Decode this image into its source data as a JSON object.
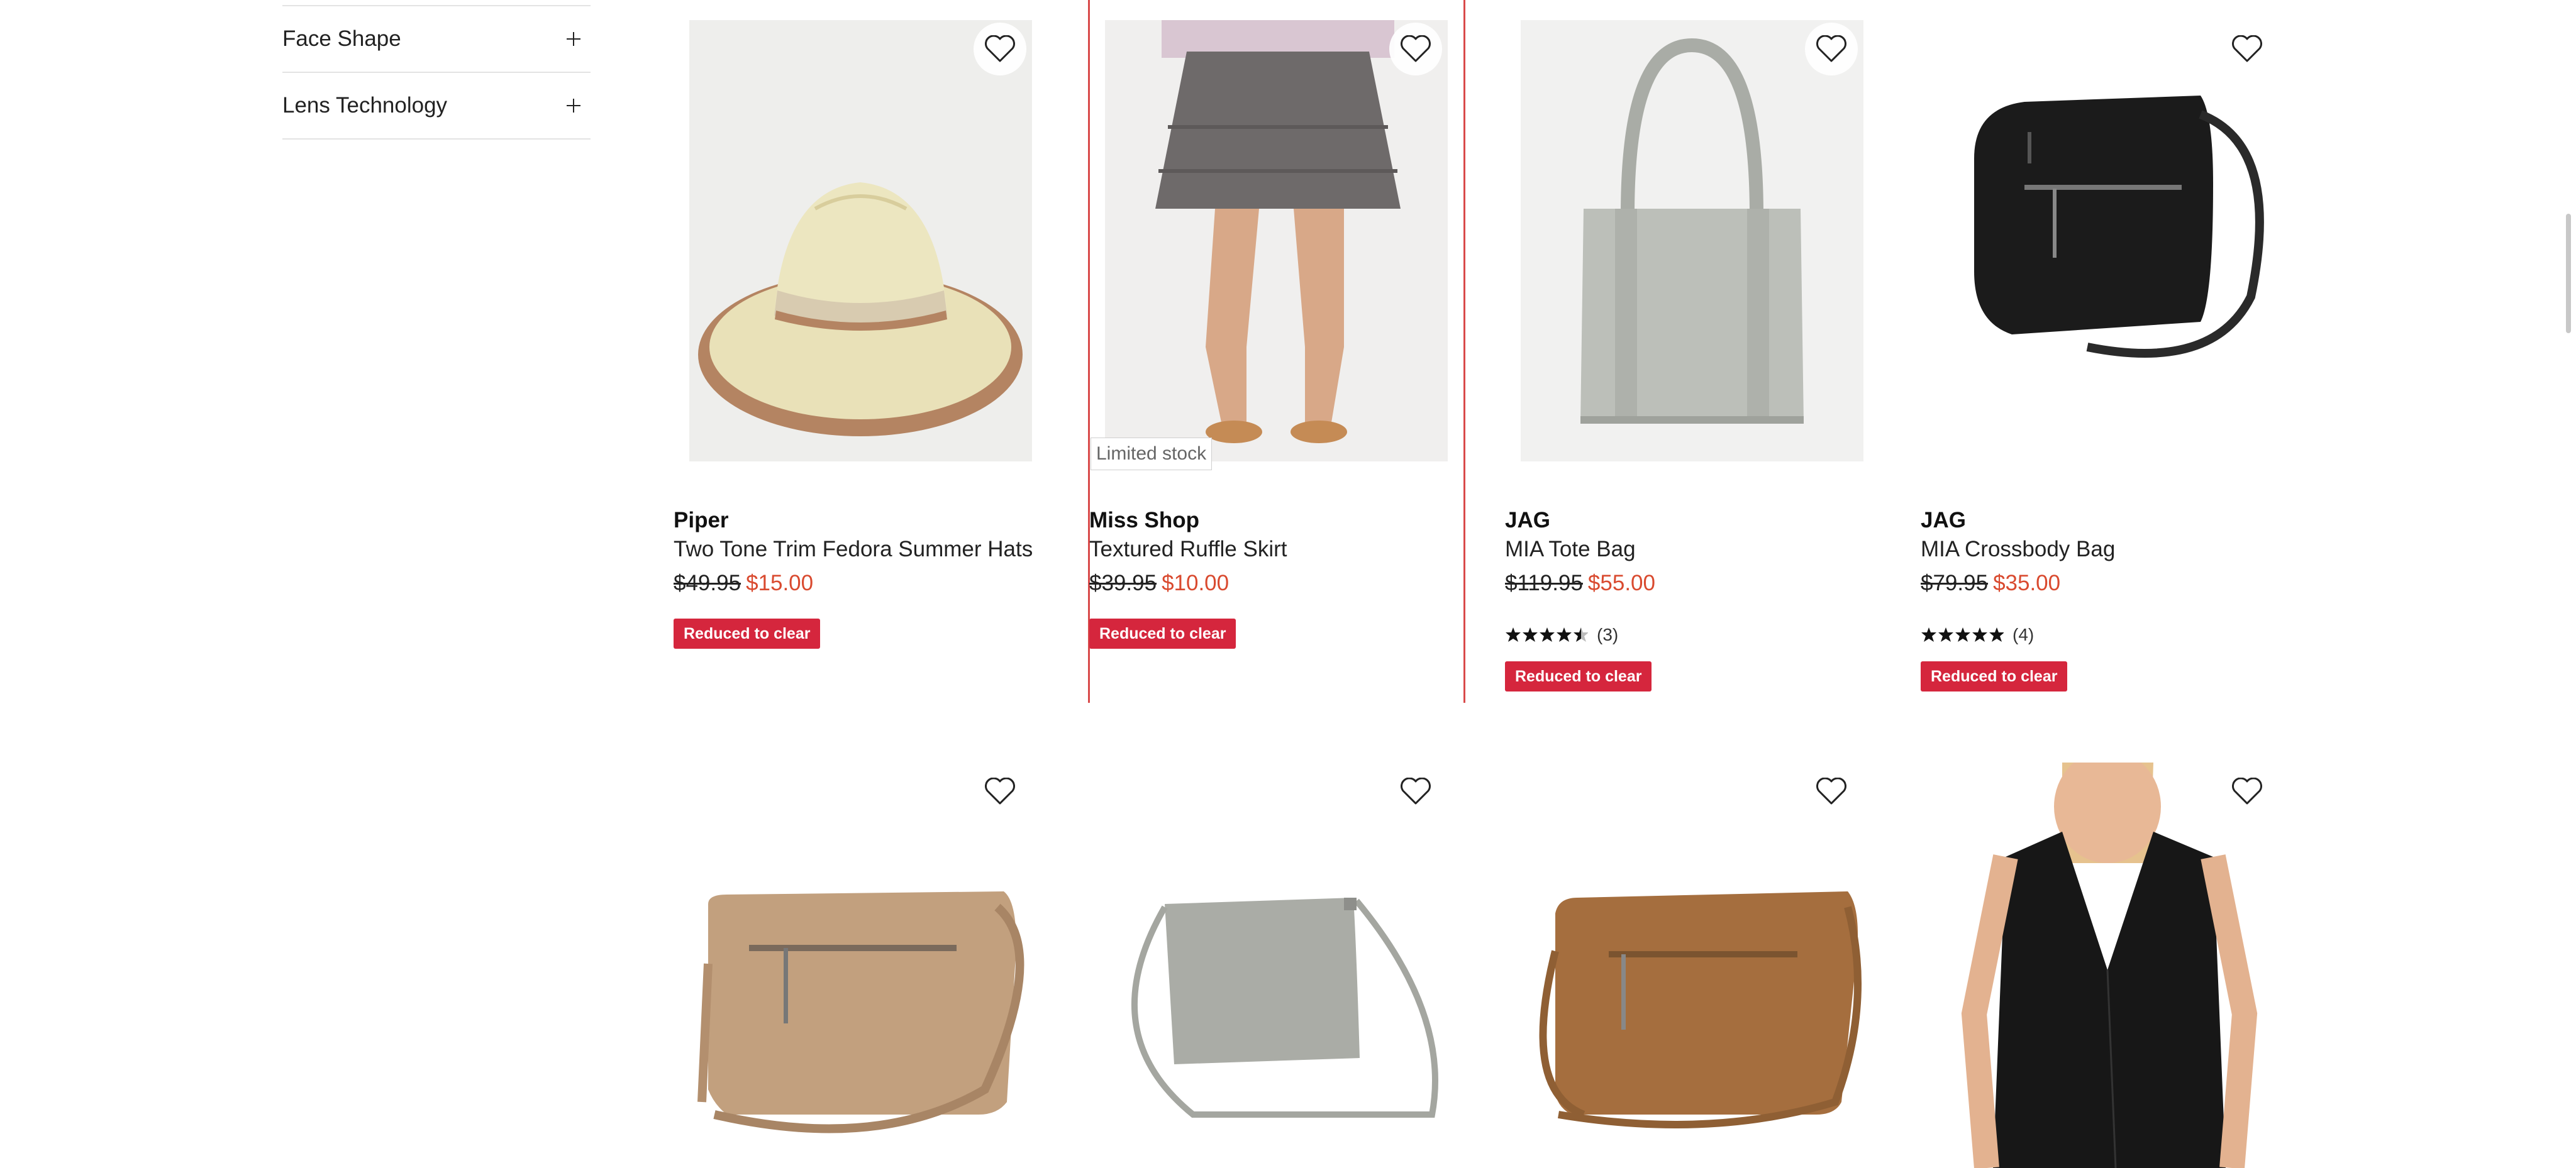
{
  "filters": [
    {
      "label": "Face Shape"
    },
    {
      "label": "Lens Technology"
    }
  ],
  "products": [
    {
      "brand": "Piper",
      "name": "Two Tone Trim Fedora Summer Hats",
      "was": "$49.95",
      "now": "$15.00",
      "badge": "Reduced to clear"
    },
    {
      "brand": "Miss Shop",
      "name": "Textured Ruffle Skirt",
      "was": "$39.95",
      "now": "$10.00",
      "badge": "Reduced to clear",
      "stock": "Limited stock"
    },
    {
      "brand": "JAG",
      "name": "MIA Tote Bag",
      "was": "$119.95",
      "now": "$55.00",
      "rating": 4.5,
      "reviews": "(3)",
      "badge": "Reduced to clear"
    },
    {
      "brand": "JAG",
      "name": "MIA Crossbody Bag",
      "was": "$79.95",
      "now": "$35.00",
      "rating": 5,
      "reviews": "(4)",
      "badge": "Reduced to clear"
    }
  ],
  "colors": {
    "sale_price": "#d94a2f",
    "badge_bg": "#d5263d",
    "hover_frame": "#d94a4a"
  }
}
